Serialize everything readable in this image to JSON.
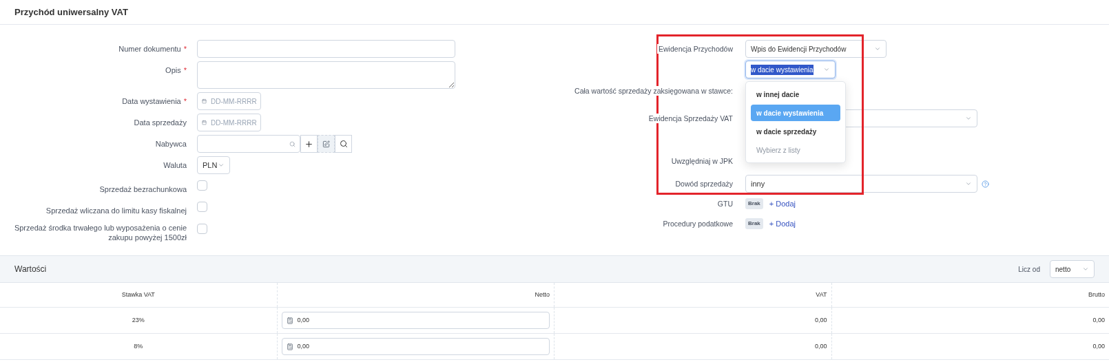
{
  "title": "Przychód uniwersalny VAT",
  "left_fields": [
    {
      "kind": "text",
      "label": "Numer dokumentu",
      "required_mark": "*"
    },
    {
      "kind": "textarea",
      "label": "Opis",
      "required_mark": "*"
    },
    {
      "kind": "date",
      "label": "Data wystawienia",
      "required_mark": "*",
      "placeholder": "DD-MM-RRRR"
    },
    {
      "kind": "date",
      "label": "Data sprzedaży",
      "placeholder": "DD-MM-RRRR"
    },
    {
      "kind": "buyer",
      "label": "Nabywca"
    },
    {
      "kind": "select",
      "label": "Waluta",
      "value": "PLN"
    },
    {
      "kind": "checkbox",
      "label": "Sprzedaż bezrachunkowa",
      "checked": false
    },
    {
      "kind": "checkbox",
      "label": "Sprzedaż wliczana do limitu kasy fiskalnej",
      "checked": false
    },
    {
      "kind": "checkbox",
      "label": "Sprzedaż środka trwałego lub wyposażenia o cenie zakupu powyżej 1500zł",
      "checked": false
    }
  ],
  "right_fields": [
    {
      "kind": "select",
      "label": "Ewidencja Przychodów",
      "value": "Wpis do Ewidencji Przychodów"
    },
    {
      "kind": "open_select",
      "value": "w dacie wystawienia",
      "expanded": true,
      "options": [
        {
          "kind": "option",
          "label": "w innej dacie",
          "selected": false
        },
        {
          "kind": "option",
          "label": "w dacie wystawienia",
          "selected": true
        },
        {
          "kind": "option",
          "label": "w dacie sprzedaży",
          "selected": false
        },
        {
          "kind": "placeholder",
          "label": "Wybierz z listy",
          "selected": false
        }
      ]
    },
    {
      "kind": "label",
      "label": "Cała wartość sprzedaży zaksięgowana w stawce:"
    },
    {
      "kind": "wide_select",
      "label": "Ewidencja Sprzedaży VAT"
    },
    {
      "kind": "label",
      "label": "Uwzględniaj w JPK"
    },
    {
      "kind": "wide_select",
      "label": "Dowód sprzedaży",
      "value": "inny",
      "help": true
    },
    {
      "kind": "tags",
      "label": "GTU",
      "badge": "Brak",
      "add": "+ Dodaj"
    },
    {
      "kind": "tags",
      "label": "Procedury podatkowe",
      "badge": "Brak",
      "add": "+ Dodaj"
    }
  ],
  "highlight_frame": true,
  "values": {
    "title": "Wartości",
    "calc_label": "Licz od",
    "calc_value": "netto",
    "columns": [
      "Stawka VAT",
      "Netto",
      "VAT",
      "Brutto"
    ],
    "rows": [
      {
        "rate": "23%",
        "net": "0,00",
        "vat": "0,00",
        "gross": "0,00"
      },
      {
        "rate": "8%",
        "net": "0,00",
        "vat": "0,00",
        "gross": "0,00"
      }
    ]
  }
}
